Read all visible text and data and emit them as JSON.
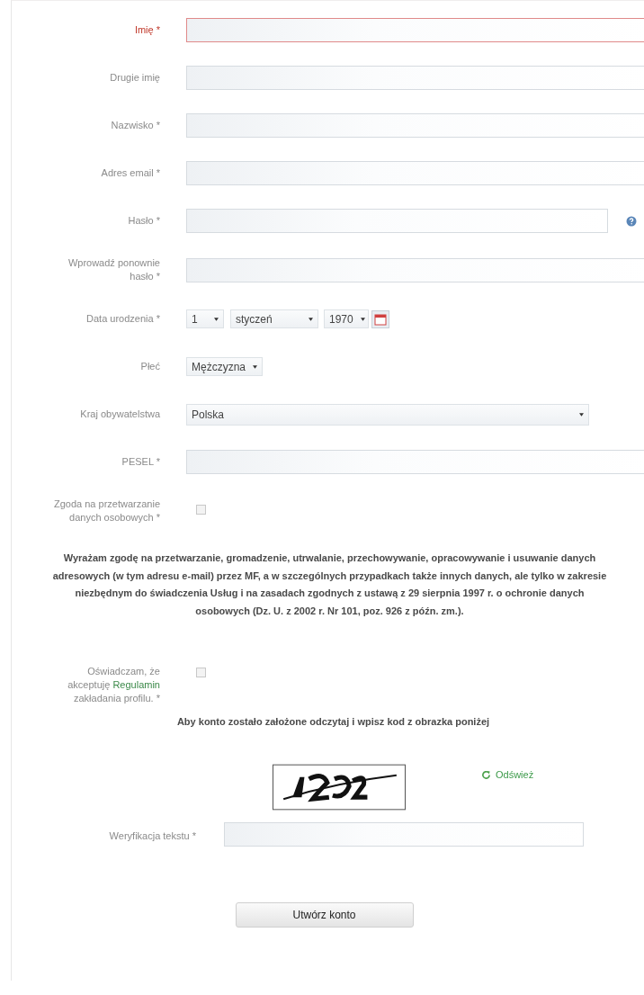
{
  "fields": [
    {
      "label": "Imię *",
      "kind": "text",
      "invalid": true
    },
    {
      "label": "Drugie imię",
      "kind": "text",
      "invalid": false
    },
    {
      "label": "Nazwisko *",
      "kind": "text",
      "invalid": false
    },
    {
      "label": "Adres email *",
      "kind": "text",
      "invalid": false
    },
    {
      "label": "Hasło *",
      "kind": "password",
      "invalid": false
    },
    {
      "label": "Wprowadź ponownie hasło *",
      "kind": "text",
      "invalid": false
    },
    {
      "label": "Data urodzenia *",
      "kind": "date",
      "day": "1",
      "month": "styczeń",
      "year": "1970"
    },
    {
      "label": "Płeć",
      "kind": "select",
      "value": "Mężczyzna"
    },
    {
      "label": "Kraj obywatelstwa",
      "kind": "select_wide",
      "value": "Polska"
    },
    {
      "label": "PESEL *",
      "kind": "text",
      "invalid": false
    },
    {
      "label": "Zgoda na przetwarzanie danych osobowych *",
      "kind": "checkbox",
      "checked": false
    }
  ],
  "consent_text": "Wyrażam zgodę na przetwarzanie, gromadzenie, utrwalanie, przechowywanie, opracowywanie i usuwanie danych adresowych (w tym adresu e-mail) przez MF, a w szczególnych przypadkach także innych danych, ale tylko w zakresie niezbędnym do świadczenia Usług i na zasadach zgodnych z ustawą z 29 sierpnia 1997 r. o ochronie danych osobowych (Dz. U. z 2002 r. Nr 101, poz. 926 z późn. zm.).",
  "terms": {
    "before": "Oświadczam, że akceptuję",
    "link": "Regulamin",
    "after": "zakładania profilu. *",
    "checked": false
  },
  "captcha": {
    "instruction": "Aby konto zostało założone odczytaj i wpisz kod z obrazka poniżej",
    "refresh": "Odśwież",
    "field_label": "Weryfikacja tekstu *"
  },
  "submit": "Utwórz konto"
}
